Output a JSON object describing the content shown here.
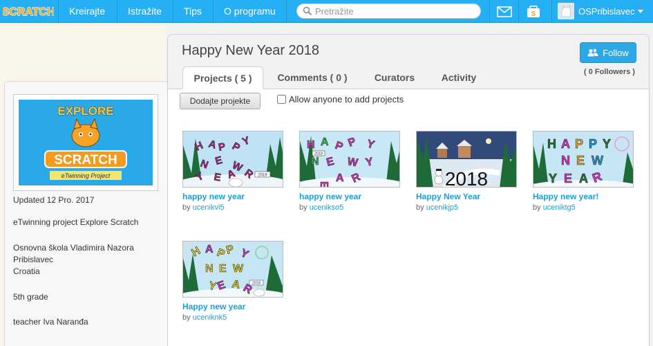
{
  "nav": {
    "logo_text": "SCRATCH",
    "items": [
      {
        "label": "Kreirajte"
      },
      {
        "label": "Istražite"
      },
      {
        "label": "Tips"
      },
      {
        "label": "O programu"
      }
    ],
    "search_placeholder": "Pretražite",
    "user_name": "OSPribislavec",
    "icons": [
      "messages-icon",
      "my-stuff-icon"
    ]
  },
  "sidebar": {
    "thumb": {
      "top_text": "EXPLORE",
      "main_text": "SCRATCH",
      "sub_text": "eTwinning Project"
    },
    "updated": "Updated 12 Pro. 2017",
    "description_lines": [
      "eTwinning project Explore Scratch",
      "Osnovna škola Vladimira Nazora",
      "Pribislavec",
      "Croatia",
      "5th grade",
      "teacher Iva Naranđa"
    ]
  },
  "studio": {
    "title": "Happy New Year 2018",
    "follow_label": "Follow",
    "followers": "( 0 Followers )",
    "tabs": [
      {
        "label": "Projects ( 5 )",
        "active": true
      },
      {
        "label": "Comments ( 0 )",
        "active": false
      },
      {
        "label": "Curators",
        "active": false
      },
      {
        "label": "Activity",
        "active": false
      }
    ],
    "add_button": "Dodajte projekte",
    "allow_label": "Allow anyone to add projects",
    "allow_checked": false,
    "by_prefix": "by",
    "projects": [
      {
        "title": "happy new year",
        "author": "ucenikvi5",
        "thumb_text": "HAPPY NEW YEAR",
        "thumb_year": "2018"
      },
      {
        "title": "happy new year",
        "author": "ucenikso5",
        "thumb_text": "HAPPY NEW YEAR",
        "thumb_year": "2018"
      },
      {
        "title": "Happy New Year",
        "author": "ucenikjp5",
        "thumb_text": "2018",
        "thumb_year": ""
      },
      {
        "title": "Happy new year!",
        "author": "uceniktg5",
        "thumb_text": "HAPPY NEW YEAR",
        "thumb_year": ""
      },
      {
        "title": "Happy new year",
        "author": "uceniknk5",
        "thumb_text": "HAPPY NEW YEAR",
        "thumb_year": "2018"
      }
    ]
  },
  "colors": {
    "nav_bg": "#25aff4",
    "link": "#1aa0d8",
    "follow_bg": "#2da8e6"
  }
}
